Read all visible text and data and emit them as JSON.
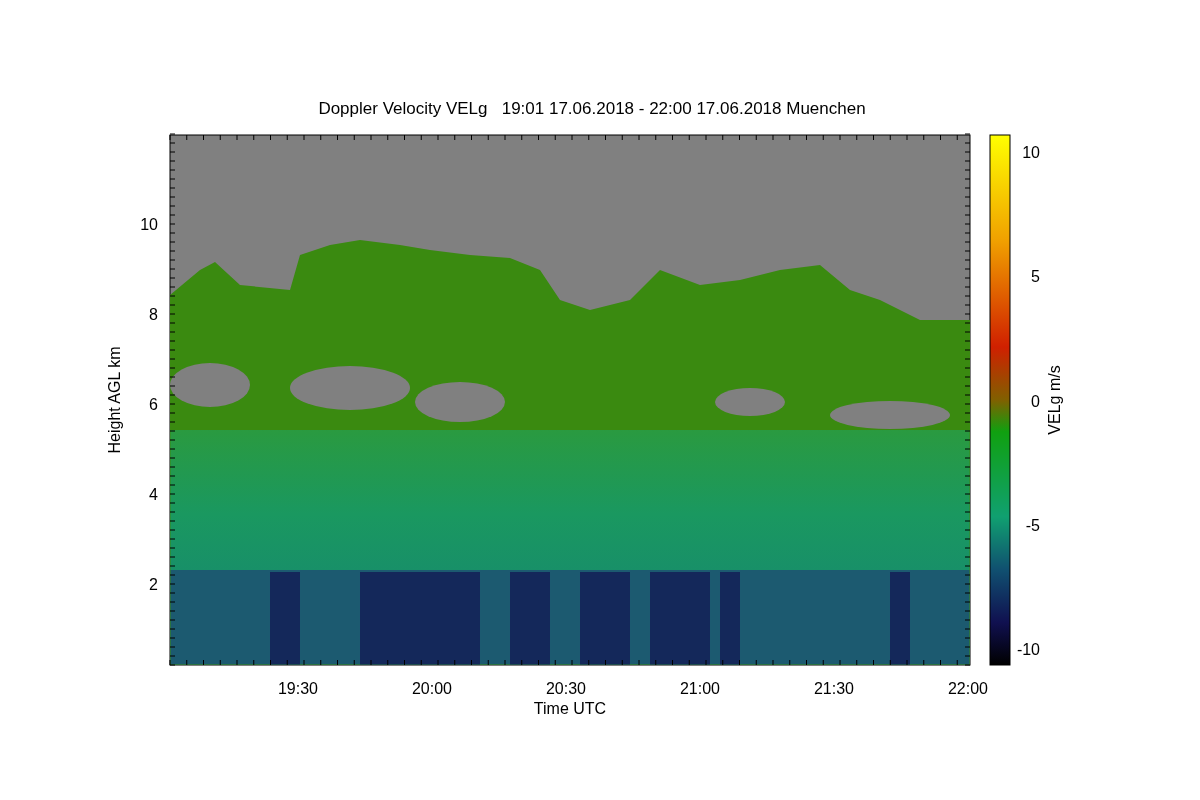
{
  "title": "Doppler Velocity VELg   19:01 17.06.2018 - 22:00 17.06.2018 Muenchen",
  "y_axis": {
    "label": "Height AGL km",
    "ticks": [
      "10",
      "8",
      "6",
      "4",
      "2"
    ]
  },
  "x_axis": {
    "label": "Time UTC",
    "ticks": [
      "19:30",
      "20:00",
      "20:30",
      "21:00",
      "21:30",
      "22:00"
    ]
  },
  "colorbar": {
    "label": "VELg m/s",
    "ticks": [
      "10",
      "5",
      "0",
      "-5",
      "-10"
    ]
  }
}
